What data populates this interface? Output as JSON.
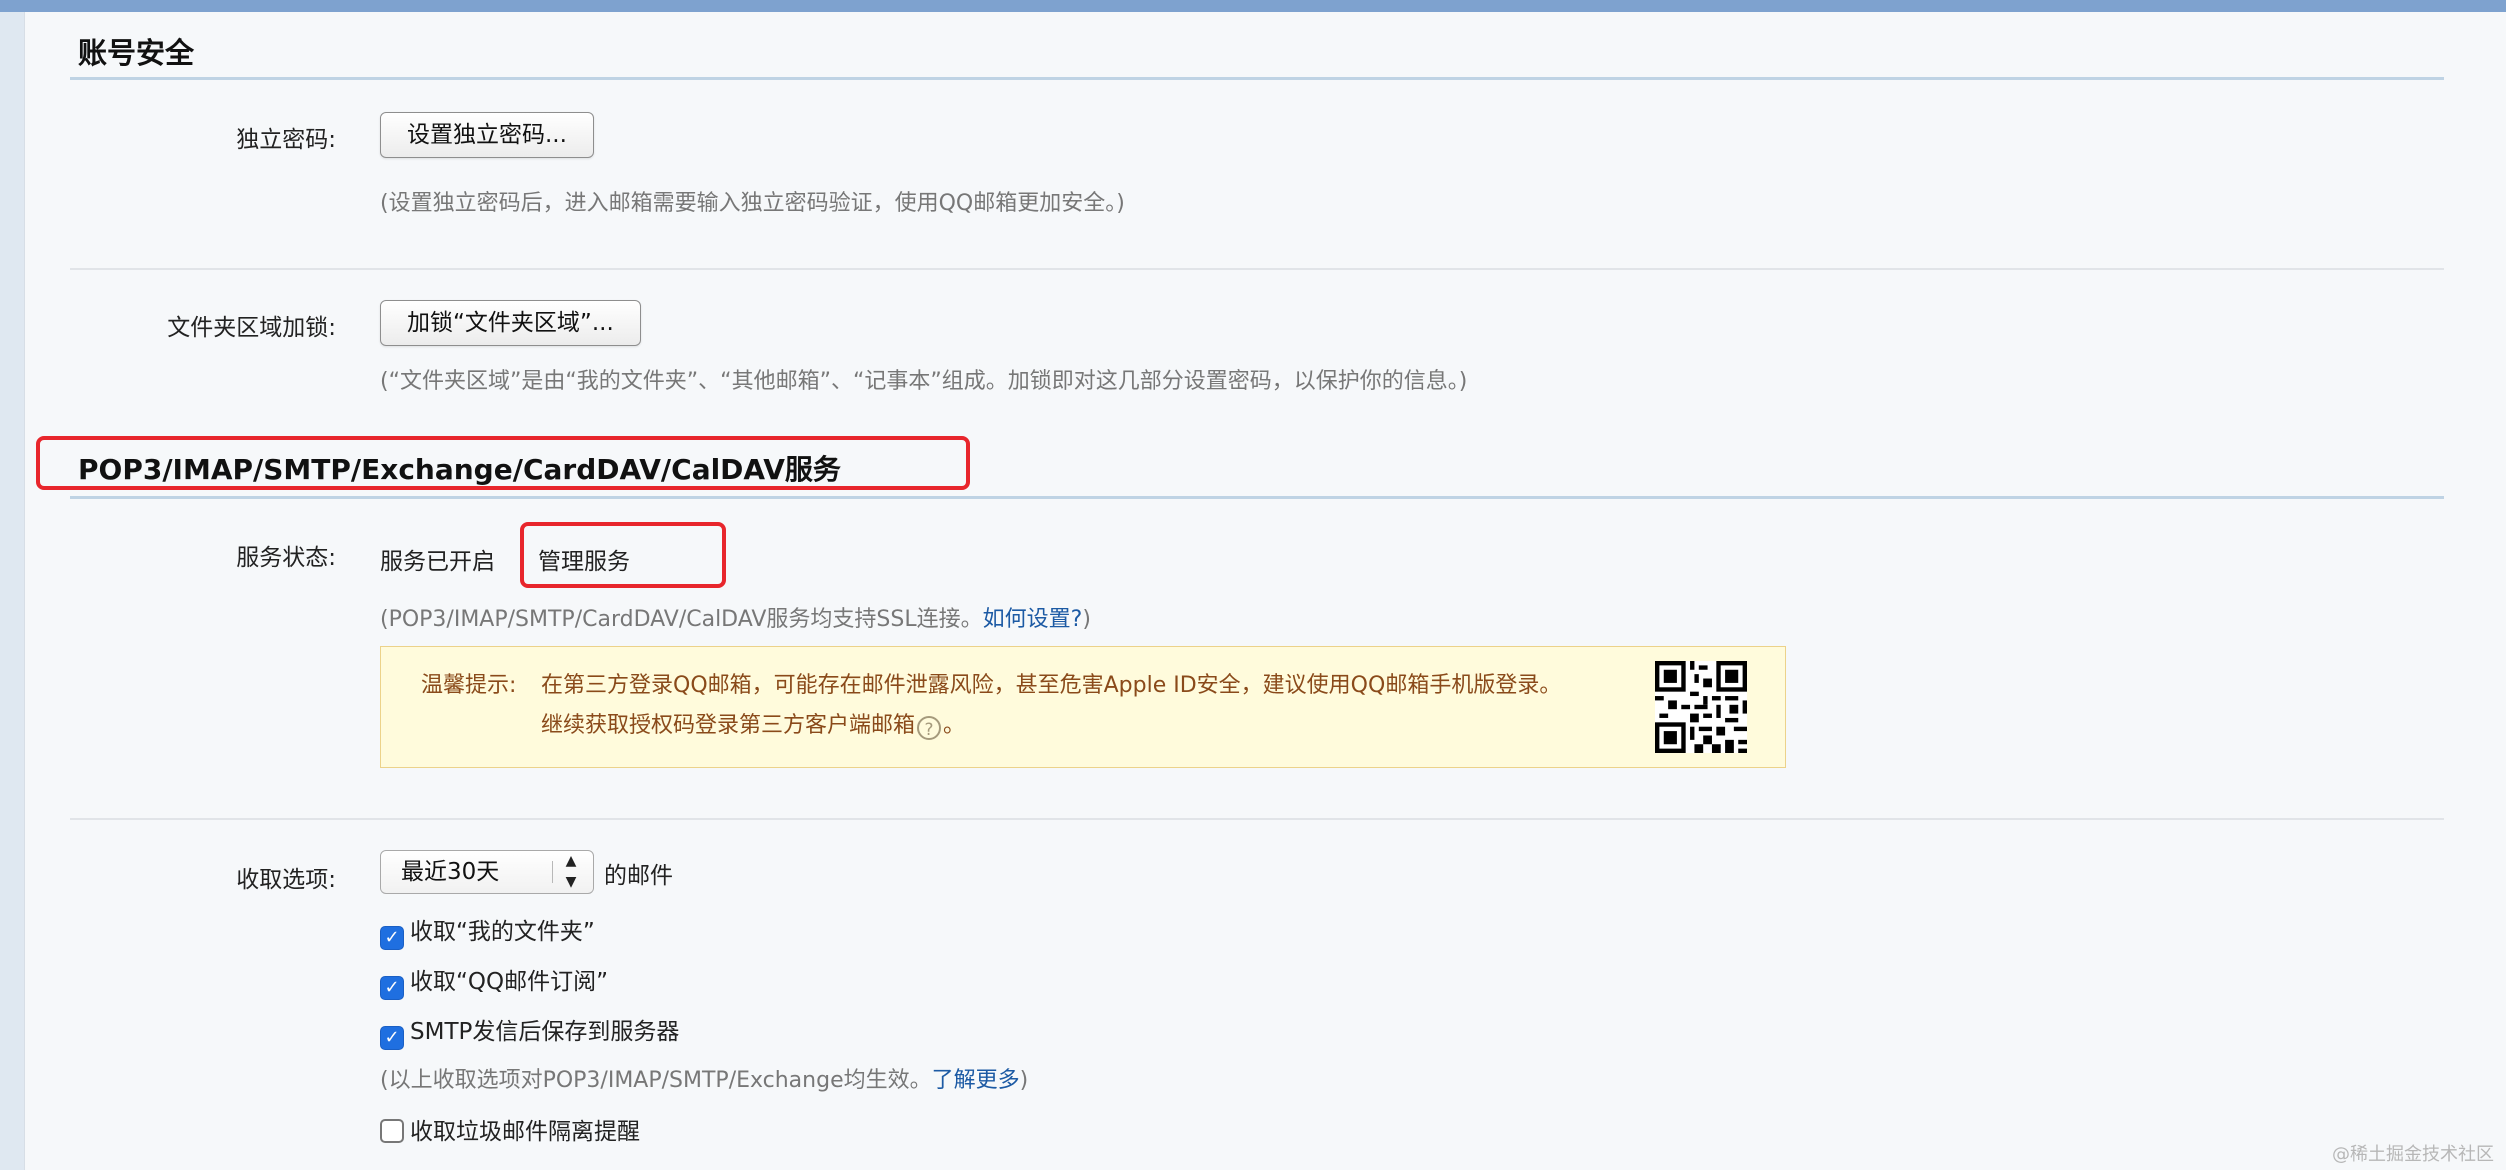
{
  "account_security": {
    "title": "账号安全",
    "independent_password": {
      "label": "独立密码:",
      "button": "设置独立密码...",
      "hint": "(设置独立密码后，进入邮箱需要输入独立密码验证，使用QQ邮箱更加安全。)"
    },
    "folder_lock": {
      "label": "文件夹区域加锁:",
      "button": "加锁“文件夹区域”...",
      "hint": "(“文件夹区域”是由“我的文件夹”、“其他邮箱”、“记事本”组成。加锁即对这几部分设置密码，以保护你的信息。)"
    }
  },
  "pop3_section": {
    "title": "POP3/IMAP/SMTP/Exchange/CardDAV/CalDAV服务",
    "service_status": {
      "label": "服务状态:",
      "status": "服务已开启",
      "manage_link": "管理服务",
      "hint_prefix": "(POP3/IMAP/SMTP/CardDAV/CalDAV服务均支持SSL连接。",
      "hint_link": "如何设置?",
      "hint_suffix": ")"
    },
    "notice": {
      "label": "温馨提示:",
      "line1": "在第三方登录QQ邮箱，可能存在邮件泄露风险，甚至危害Apple ID安全，建议使用QQ邮箱手机版登录。",
      "line2_prefix": "继续获取授权码登录第三方客户端邮箱",
      "help_icon": "question-circle-icon",
      "line2_suffix": "。"
    },
    "receive_options": {
      "label": "收取选项:",
      "select_value": "最近30天",
      "select_suffix": "的邮件",
      "checkboxes": [
        {
          "label": "收取“我的文件夹”",
          "checked": true
        },
        {
          "label": "收取“QQ邮件订阅”",
          "checked": true
        },
        {
          "label": "SMTP发信后保存到服务器",
          "checked": true
        }
      ],
      "hint_prefix": "(以上收取选项对POP3/IMAP/SMTP/Exchange均生效。",
      "hint_link": "了解更多",
      "hint_suffix": ")",
      "spam_checkbox": {
        "label": "收取垃圾邮件隔离提醒",
        "checked": false
      }
    }
  },
  "watermark": "@稀土掘金技术社区",
  "colors": {
    "highlight_box": "#e8262c",
    "link": "#1c5aa4",
    "checkbox_on": "#1f6fe0"
  }
}
